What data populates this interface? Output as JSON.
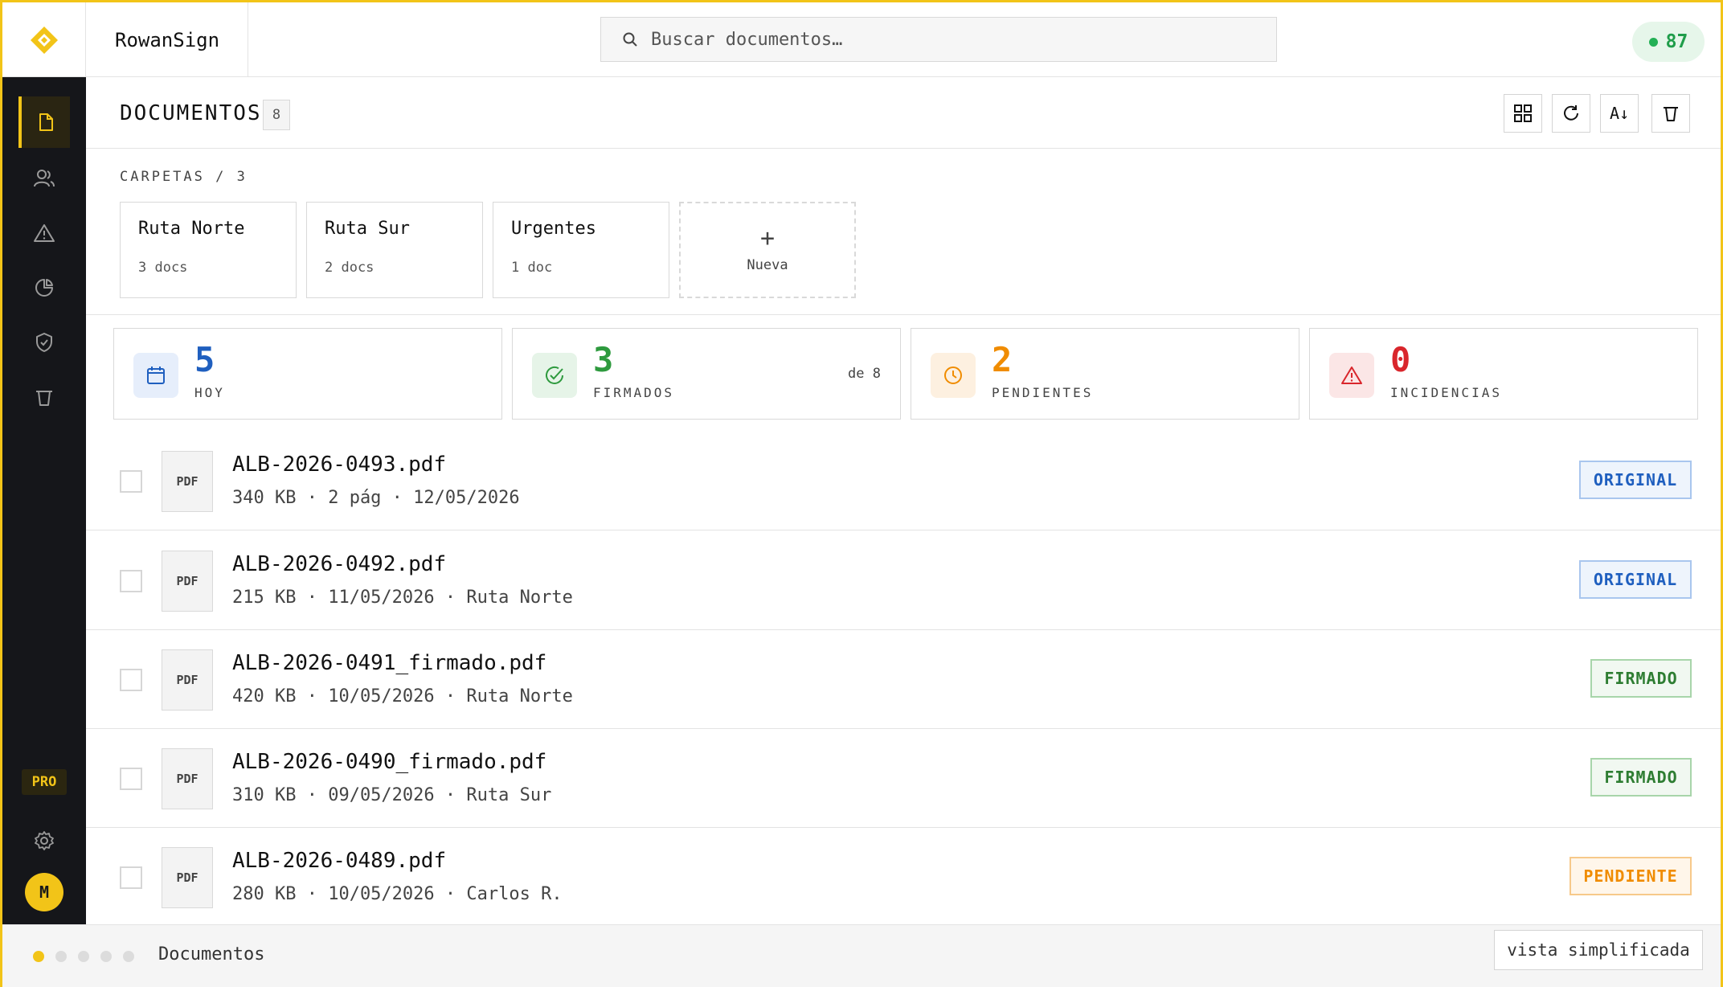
{
  "app": {
    "name": "RowanSign",
    "score": "87"
  },
  "search": {
    "placeholder": "Buscar documentos…"
  },
  "sidebar": {
    "items": [
      {
        "icon": "document-icon",
        "active": true
      },
      {
        "icon": "users-icon"
      },
      {
        "icon": "warning-icon"
      },
      {
        "icon": "pie-chart-icon"
      },
      {
        "icon": "shield-icon"
      },
      {
        "icon": "trash-icon"
      }
    ],
    "plan": "PRO",
    "avatar_initial": "M"
  },
  "header": {
    "title": "DOCUMENTOS",
    "count": "8",
    "tools": [
      "grid-icon",
      "refresh-icon",
      "sort-az-icon",
      "trash-icon"
    ],
    "sort_label": "A↓"
  },
  "folders": {
    "label": "CARPETAS / 3",
    "items": [
      {
        "name": "Ruta Norte",
        "count": "3 docs"
      },
      {
        "name": "Ruta Sur",
        "count": "2 docs"
      },
      {
        "name": "Urgentes",
        "count": "1 doc"
      }
    ],
    "new_label": "Nueva",
    "new_symbol": "+"
  },
  "stats": [
    {
      "value": "5",
      "label": "HOY",
      "extra": "",
      "color": "#1f5fbf",
      "bg": "#e6eefb",
      "icon": "calendar-icon"
    },
    {
      "value": "3",
      "label": "FIRMADOS",
      "extra": "de 8",
      "color": "#2e9a3e",
      "bg": "#e6f4e8",
      "icon": "check-circle-icon"
    },
    {
      "value": "2",
      "label": "PENDIENTES",
      "extra": "",
      "color": "#f08c00",
      "bg": "#fdf0e0",
      "icon": "clock-icon"
    },
    {
      "value": "0",
      "label": "INCIDENCIAS",
      "extra": "",
      "color": "#d9262c",
      "bg": "#fbe6e6",
      "icon": "warning-icon"
    }
  ],
  "documents": [
    {
      "type": "PDF",
      "name": "ALB-2026-0493.pdf",
      "meta": "340 KB · 2 pág · 12/05/2026",
      "status": "ORIGINAL"
    },
    {
      "type": "PDF",
      "name": "ALB-2026-0492.pdf",
      "meta": "215 KB · 11/05/2026 · Ruta Norte",
      "status": "ORIGINAL"
    },
    {
      "type": "PDF",
      "name": "ALB-2026-0491_firmado.pdf",
      "meta": "420 KB · 10/05/2026 · Ruta Norte",
      "status": "FIRMADO"
    },
    {
      "type": "PDF",
      "name": "ALB-2026-0490_firmado.pdf",
      "meta": "310 KB · 09/05/2026 · Ruta Sur",
      "status": "FIRMADO"
    },
    {
      "type": "PDF",
      "name": "ALB-2026-0489.pdf",
      "meta": "280 KB · 10/05/2026 · Carlos R.",
      "status": "PENDIENTE"
    }
  ],
  "status_colors": {
    "ORIGINAL": {
      "fg": "#1f5fbf",
      "bg": "#eef4fc",
      "border": "#a9c6ee"
    },
    "FIRMADO": {
      "fg": "#2e7d32",
      "bg": "#f1f8f1",
      "border": "#a8d5aa"
    },
    "PENDIENTE": {
      "fg": "#f08c00",
      "bg": "#fff6ea",
      "border": "#f7c98a"
    }
  },
  "footer": {
    "label": "Documentos",
    "simple_view": "vista simplificada",
    "page_count": 5,
    "active_page": 1
  },
  "accent": "#f2c418"
}
